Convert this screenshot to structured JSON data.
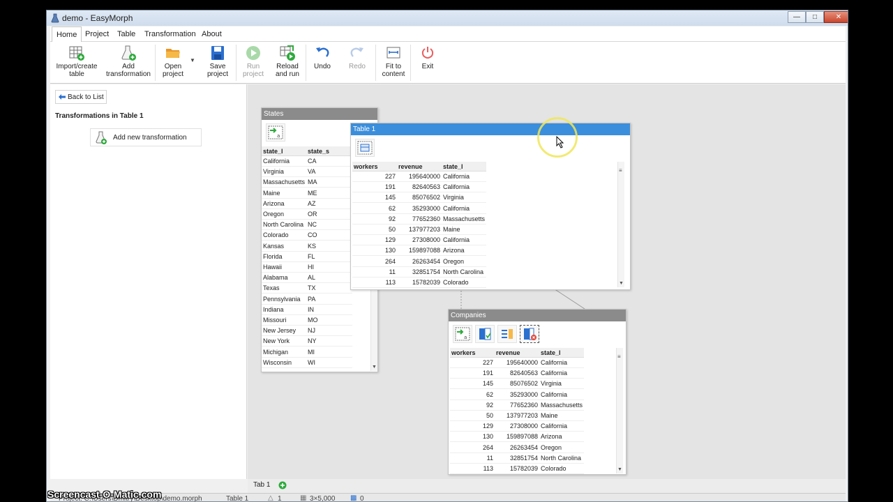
{
  "window": {
    "title": "demo - EasyMorph"
  },
  "menu": [
    "Home",
    "Project",
    "Table",
    "Transformation",
    "About"
  ],
  "ribbon": [
    {
      "label1": "Import/create",
      "label2": "table"
    },
    {
      "label1": "Add",
      "label2": "transformation"
    },
    {
      "label1": "Open",
      "label2": "project"
    },
    {
      "label1": "Save",
      "label2": "project"
    },
    {
      "label1": "Run",
      "label2": "project"
    },
    {
      "label1": "Reload",
      "label2": "and run"
    },
    {
      "label1": "Undo",
      "label2": ""
    },
    {
      "label1": "Redo",
      "label2": ""
    },
    {
      "label1": "Fit to",
      "label2": "content"
    },
    {
      "label1": "Exit",
      "label2": ""
    }
  ],
  "left_panel": {
    "back_label": "Back to List",
    "heading": "Transformations in Table 1",
    "add_label": "Add new transformation"
  },
  "states_table": {
    "title": "States",
    "columns": [
      "state_l",
      "state_s"
    ],
    "rows": [
      [
        "California",
        "CA"
      ],
      [
        "Virginia",
        "VA"
      ],
      [
        "Massachusetts",
        "MA"
      ],
      [
        "Maine",
        "ME"
      ],
      [
        "Arizona",
        "AZ"
      ],
      [
        "Oregon",
        "OR"
      ],
      [
        "North Carolina",
        "NC"
      ],
      [
        "Colorado",
        "CO"
      ],
      [
        "Kansas",
        "KS"
      ],
      [
        "Florida",
        "FL"
      ],
      [
        "Hawaii",
        "HI"
      ],
      [
        "Alabama",
        "AL"
      ],
      [
        "Texas",
        "TX"
      ],
      [
        "Pennsylvania",
        "PA"
      ],
      [
        "Indiana",
        "IN"
      ],
      [
        "Missouri",
        "MO"
      ],
      [
        "New Jersey",
        "NJ"
      ],
      [
        "New York",
        "NY"
      ],
      [
        "Michigan",
        "MI"
      ],
      [
        "Wisconsin",
        "WI"
      ]
    ]
  },
  "table1": {
    "title": "Table 1",
    "columns": [
      "workers",
      "revenue",
      "state_l"
    ],
    "rows": [
      [
        "227",
        "195640000",
        "California"
      ],
      [
        "191",
        "82640563",
        "California"
      ],
      [
        "145",
        "85076502",
        "Virginia"
      ],
      [
        "62",
        "35293000",
        "California"
      ],
      [
        "92",
        "77652360",
        "Massachusetts"
      ],
      [
        "50",
        "137977203",
        "Maine"
      ],
      [
        "129",
        "27308000",
        "California"
      ],
      [
        "130",
        "159897088",
        "Arizona"
      ],
      [
        "264",
        "26263454",
        "Oregon"
      ],
      [
        "11",
        "32851754",
        "North Carolina"
      ],
      [
        "113",
        "15782039",
        "Colorado"
      ]
    ]
  },
  "companies_table": {
    "title": "Companies",
    "columns": [
      "workers",
      "revenue",
      "state_l"
    ],
    "rows": [
      [
        "227",
        "195640000",
        "California"
      ],
      [
        "191",
        "82640563",
        "California"
      ],
      [
        "145",
        "85076502",
        "Virginia"
      ],
      [
        "62",
        "35293000",
        "California"
      ],
      [
        "92",
        "77652360",
        "Massachusetts"
      ],
      [
        "50",
        "137977203",
        "Maine"
      ],
      [
        "129",
        "27308000",
        "California"
      ],
      [
        "130",
        "159897088",
        "Arizona"
      ],
      [
        "264",
        "26263454",
        "Oregon"
      ],
      [
        "11",
        "32851754",
        "North Carolina"
      ],
      [
        "113",
        "15782039",
        "Colorado"
      ]
    ]
  },
  "tabs": {
    "tab1": "Tab 1"
  },
  "status": {
    "project": "Project: C:\\Users\\Dmitry\\Desktop\\demo.morph",
    "table": "Table 1",
    "transforms": "1",
    "size": "3×5,000",
    "errors": "0"
  },
  "watermark": "Screencast-O-Matic.com",
  "colors": {
    "accent": "#3b8edb",
    "green": "#2eaa3c",
    "orange": "#f2a83a",
    "red": "#e04a3a"
  }
}
